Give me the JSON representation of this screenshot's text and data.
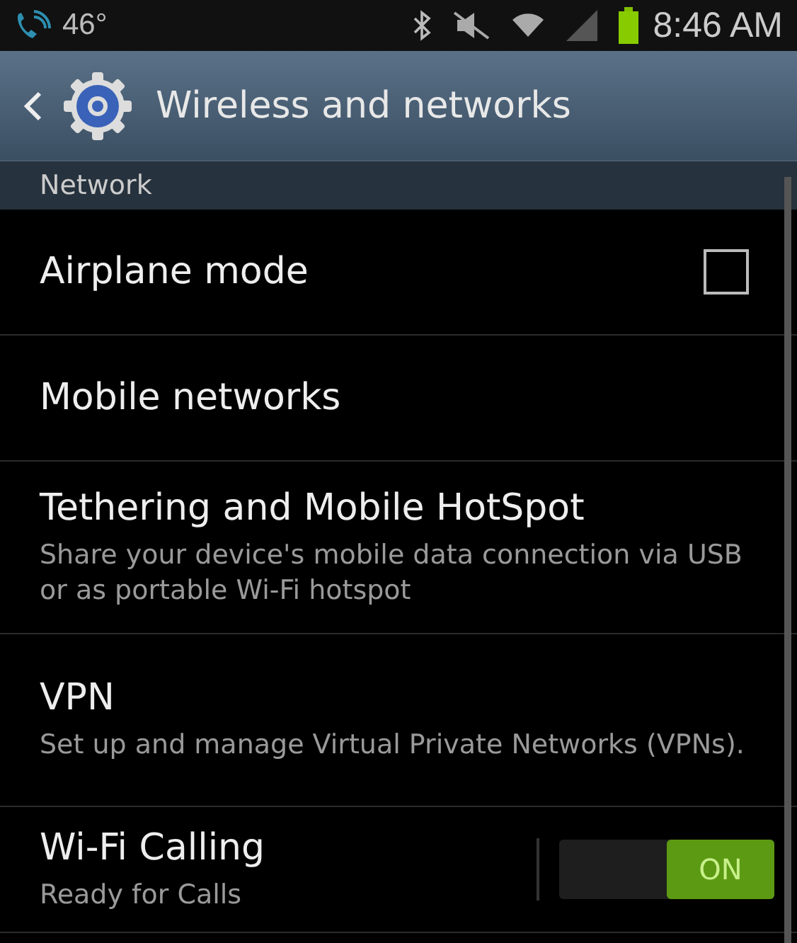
{
  "status_bar": {
    "temperature": "46°",
    "time": "8:46 AM"
  },
  "header": {
    "title": "Wireless and networks"
  },
  "section": {
    "title": "Network"
  },
  "items": [
    {
      "kind": "checkbox",
      "title": "Airplane mode",
      "checked": false
    },
    {
      "kind": "plain",
      "title": "Mobile networks"
    },
    {
      "kind": "plain",
      "title": "Tethering and Mobile HotSpot",
      "summary": "Share your device's mobile data connection via USB or as portable Wi-Fi hotspot"
    },
    {
      "kind": "plain",
      "title": "VPN",
      "summary": "Set up and manage Virtual Private Networks (VPNs)."
    },
    {
      "kind": "switch",
      "title": "Wi-Fi Calling",
      "summary": "Ready for Calls",
      "on": true,
      "switch_label": "ON"
    }
  ]
}
